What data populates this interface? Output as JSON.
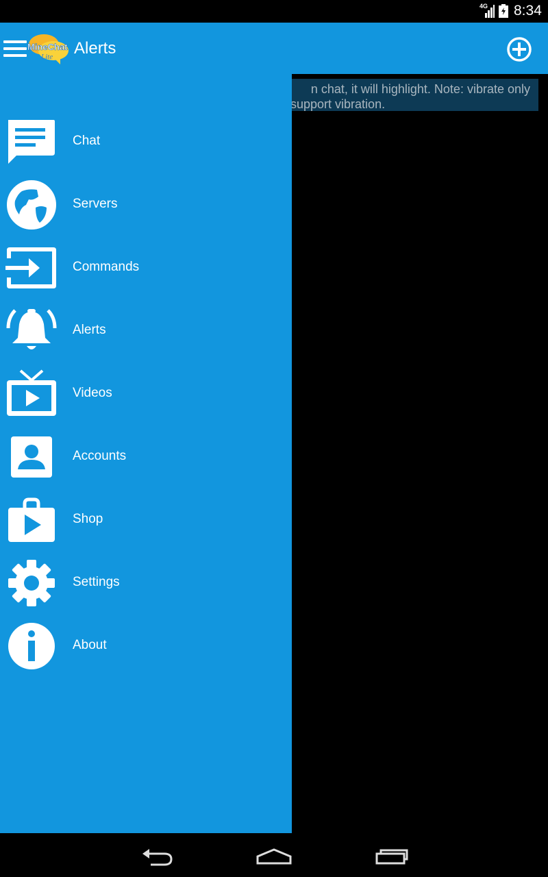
{
  "status": {
    "network": "4G",
    "time": "8:34"
  },
  "header": {
    "title": "Alerts",
    "logo_text": "MineChat",
    "logo_sub": "Lite"
  },
  "content": {
    "notice_line1": "n chat, it will highlight.  Note: vibrate only",
    "notice_line2": "support vibration."
  },
  "menu": [
    {
      "label": "Chat",
      "icon": "chat-icon"
    },
    {
      "label": "Servers",
      "icon": "globe-icon"
    },
    {
      "label": "Commands",
      "icon": "input-icon"
    },
    {
      "label": "Alerts",
      "icon": "bell-icon"
    },
    {
      "label": "Videos",
      "icon": "tv-play-icon"
    },
    {
      "label": "Accounts",
      "icon": "account-icon"
    },
    {
      "label": "Shop",
      "icon": "shop-icon"
    },
    {
      "label": "Settings",
      "icon": "gear-icon"
    },
    {
      "label": "About",
      "icon": "info-icon"
    }
  ],
  "colors": {
    "accent": "#1296de",
    "notice_bg": "#0d3a55"
  }
}
